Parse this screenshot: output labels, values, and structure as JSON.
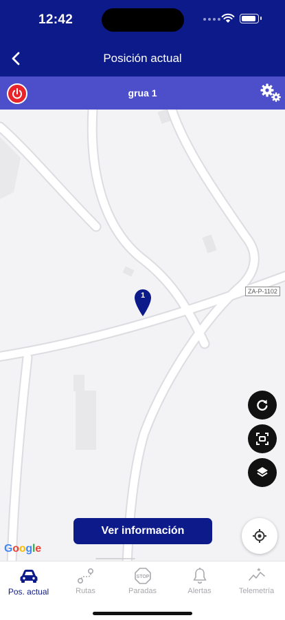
{
  "status_bar": {
    "time": "12:42",
    "battery_level": 0.9
  },
  "header": {
    "title": "Posición actual"
  },
  "vehicle_bar": {
    "vehicle_name": "grua 1"
  },
  "map": {
    "road_label": "ZA-P-1102",
    "marker_number": "1",
    "attribution": [
      "G",
      "o",
      "o",
      "g",
      "l",
      "e"
    ],
    "attribution_colors": [
      "#4285f4",
      "#ea4335",
      "#fbbc05",
      "#4285f4",
      "#34a853",
      "#ea4335"
    ]
  },
  "actions": {
    "info_button_label": "Ver información"
  },
  "tabs": [
    {
      "label": "Pos. actual",
      "icon": "car-icon",
      "active": true
    },
    {
      "label": "Rutas",
      "icon": "route-icon",
      "active": false
    },
    {
      "label": "Paradas",
      "icon": "stop-icon",
      "active": false
    },
    {
      "label": "Alertas",
      "icon": "bell-icon",
      "active": false
    },
    {
      "label": "Telemetría",
      "icon": "telemetry-icon",
      "active": false
    }
  ],
  "colors": {
    "primary": "#0d1a8a",
    "sub_bar": "#4c4fc9",
    "power": "#e8232a",
    "inactive_tab": "#a8a8ae"
  }
}
